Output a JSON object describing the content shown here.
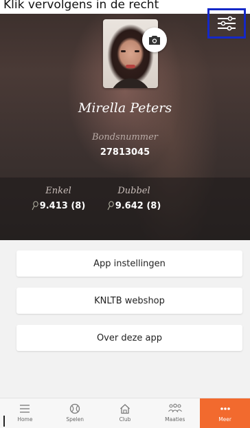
{
  "caption": "Klik vervolgens in de recht",
  "profile": {
    "name": "Mirella Peters",
    "bondsnummer_label": "Bondsnummer",
    "bondsnummer": "27813045"
  },
  "ratings": [
    {
      "label": "Enkel",
      "value": "9.413 (8)"
    },
    {
      "label": "Dubbel",
      "value": "9.642 (8)"
    }
  ],
  "icons": {
    "settings": "sliders-icon",
    "camera": "camera-icon",
    "rating": "racket-icon"
  },
  "menu": [
    {
      "label": "App instellingen"
    },
    {
      "label": "KNLTB webshop"
    },
    {
      "label": "Over deze app"
    }
  ],
  "tabs": [
    {
      "label": "Home",
      "icon": "menu-icon"
    },
    {
      "label": "Spelen",
      "icon": "tennis-ball-icon"
    },
    {
      "label": "Club",
      "icon": "house-icon"
    },
    {
      "label": "Maaties",
      "icon": "people-icon"
    },
    {
      "label": "Meer",
      "icon": "more-dots-icon",
      "active": true
    }
  ],
  "colors": {
    "accent": "#f26a2e",
    "highlight_border": "#1428c8"
  }
}
